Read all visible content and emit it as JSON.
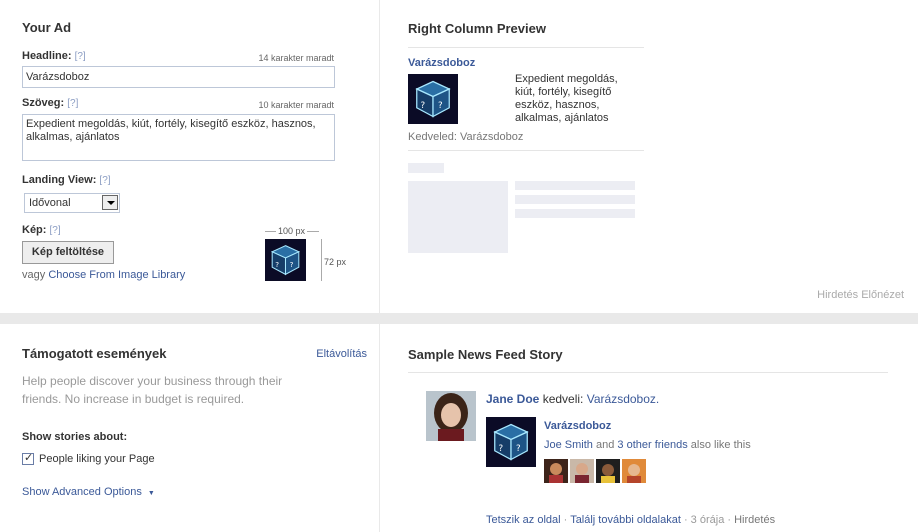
{
  "your_ad": {
    "title": "Your Ad",
    "headline_label": "Headline:",
    "help_mark": "[?]",
    "headline_counter": "14 karakter maradt",
    "headline_value": "Varázsdoboz",
    "body_label": "Szöveg:",
    "body_counter": "10 karakter maradt",
    "body_value": "Expedient megoldás, kiút, fortély, kisegítő eszköz, hasznos, alkalmas, ajánlatos",
    "landing_label": "Landing View:",
    "landing_value": "Idővonal",
    "image_label": "Kép:",
    "upload_button": "Kép feltöltése",
    "or_text": "vagy",
    "library_link": "Choose From Image Library",
    "width_text": "100 px",
    "height_text": "72 px"
  },
  "preview": {
    "title": "Right Column Preview",
    "ad_title": "Varázsdoboz",
    "ad_body": "Expedient megoldás, kiút, fortély, kisegítő eszköz, hasznos, alkalmas, ajánlatos",
    "likes": "Kedveled: Varázsdoboz",
    "footer": "Hirdetés Előnézet"
  },
  "events": {
    "title": "Támogatott események",
    "remove_link": "Eltávolítás",
    "description": "Help people discover your business through their friends. No increase in budget is required.",
    "show_label": "Show stories about:",
    "checkbox_label": "People liking your Page",
    "checkbox_checked": true,
    "advanced_link": "Show Advanced Options"
  },
  "feed": {
    "title": "Sample News Feed Story",
    "user_name": "Jane Doe",
    "action": "kedveli:",
    "page_name": "Varázsdoboz.",
    "card_title": "Varázsdoboz",
    "friend_name": "Joe Smith",
    "and_text": "and",
    "others_link": "3 other friends",
    "also_like": "also like this",
    "footer_like": "Tetszik az oldal",
    "footer_more": "Találj további oldalakat",
    "footer_time": "3 órája",
    "footer_ad": "Hirdetés",
    "separator": "·"
  },
  "colors": {
    "link": "#3b5998",
    "border": "#bdc7d8",
    "placeholder": "#ecedf3",
    "background": "#e9e9e9"
  }
}
